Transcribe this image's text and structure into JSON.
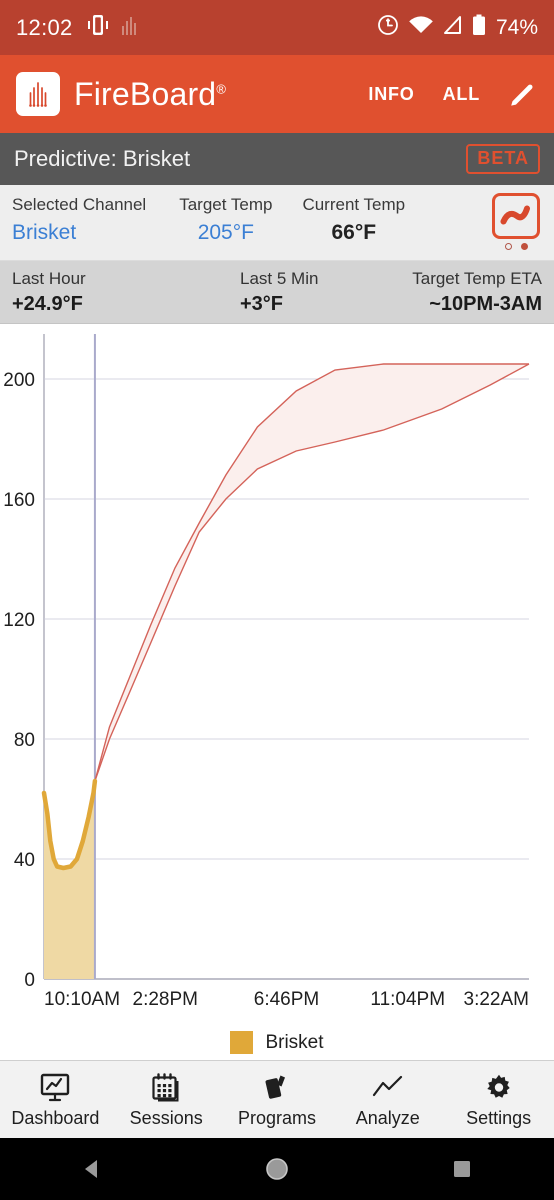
{
  "statusbar": {
    "time": "12:02",
    "battery_percent": "74%",
    "icons": [
      "vibrate-icon",
      "signal-bars-icon",
      "alarm-icon",
      "wifi-icon",
      "cell-signal-icon",
      "battery-icon"
    ]
  },
  "appbar": {
    "brand": "FireBoard",
    "registered_mark": "®",
    "info_label": "INFO",
    "all_label": "ALL",
    "edit_icon": "pencil-icon",
    "bg_color": "#e0502f"
  },
  "predictive": {
    "title": "Predictive: Brisket",
    "badge": "BETA",
    "badge_color": "#e0502f"
  },
  "info": {
    "selected_channel_label": "Selected Channel",
    "selected_channel_value": "Brisket",
    "target_temp_label": "Target Temp",
    "target_temp_value": "205°F",
    "current_temp_label": "Current Temp",
    "current_temp_value": "66°F",
    "link_color": "#3b7fd4",
    "mode_icon": "brisket-curve-icon",
    "page_dots": 2,
    "active_dot": 2
  },
  "stats": {
    "last_hour_label": "Last Hour",
    "last_hour_value": "+24.9°F",
    "last_5min_label": "Last 5 Min",
    "last_5min_value": "+3°F",
    "eta_label": "Target Temp ETA",
    "eta_value": "~10PM-3AM"
  },
  "chart_data": {
    "type": "line",
    "title": "Predictive: Brisket",
    "xlabel": "",
    "ylabel": "",
    "grid": true,
    "legend_position": "bottom",
    "ylim": [
      0,
      215
    ],
    "yticks": [
      0,
      40,
      80,
      120,
      160,
      200
    ],
    "ytick_labels": [
      "0",
      "40",
      "80",
      "120",
      "160",
      "200"
    ],
    "xtick_labels": [
      "10:10AM",
      "2:28PM",
      "6:46PM",
      "11:04PM",
      "3:22AM"
    ],
    "xtick_positions": [
      0,
      0.25,
      0.5,
      0.75,
      1.0
    ],
    "now_marker_x": 0.105,
    "colors": {
      "actual_line": "#e0a839",
      "actual_fill": "#efd9a4",
      "prediction_line": "#d4635a",
      "prediction_fill": "#fbefed",
      "grid": "#c9c9d9",
      "now_line": "#a9aacb"
    },
    "series": [
      {
        "name": "Brisket",
        "kind": "actual",
        "points": [
          [
            0.0,
            62
          ],
          [
            0.007,
            55
          ],
          [
            0.013,
            46
          ],
          [
            0.02,
            40
          ],
          [
            0.027,
            37.5
          ],
          [
            0.04,
            37
          ],
          [
            0.055,
            37.5
          ],
          [
            0.068,
            40
          ],
          [
            0.08,
            46
          ],
          [
            0.092,
            54
          ],
          [
            0.102,
            62
          ],
          [
            0.105,
            66
          ]
        ]
      },
      {
        "name": "Prediction Upper",
        "kind": "prediction-upper",
        "points": [
          [
            0.105,
            66
          ],
          [
            0.135,
            84
          ],
          [
            0.175,
            100
          ],
          [
            0.22,
            118
          ],
          [
            0.27,
            137
          ],
          [
            0.32,
            152
          ],
          [
            0.375,
            168
          ],
          [
            0.44,
            184
          ],
          [
            0.52,
            196
          ],
          [
            0.6,
            203
          ],
          [
            0.7,
            205
          ],
          [
            0.85,
            205
          ],
          [
            1.0,
            205
          ]
        ]
      },
      {
        "name": "Prediction Lower",
        "kind": "prediction-lower",
        "points": [
          [
            0.105,
            66
          ],
          [
            0.135,
            80
          ],
          [
            0.175,
            95
          ],
          [
            0.22,
            112
          ],
          [
            0.27,
            131
          ],
          [
            0.32,
            149
          ],
          [
            0.375,
            160
          ],
          [
            0.44,
            170
          ],
          [
            0.52,
            176
          ],
          [
            0.6,
            179
          ],
          [
            0.7,
            183
          ],
          [
            0.82,
            190
          ],
          [
            0.92,
            198
          ],
          [
            1.0,
            205
          ]
        ]
      }
    ],
    "legend": [
      {
        "label": "Brisket",
        "color": "#e0a839"
      }
    ]
  },
  "bottomnav": {
    "items": [
      {
        "label": "Dashboard",
        "icon": "dashboard-chart-icon"
      },
      {
        "label": "Sessions",
        "icon": "calendar-icon"
      },
      {
        "label": "Programs",
        "icon": "cards-icon"
      },
      {
        "label": "Analyze",
        "icon": "line-chart-icon"
      },
      {
        "label": "Settings",
        "icon": "gear-icon"
      }
    ]
  },
  "sysnav": {
    "back": "back-triangle-icon",
    "home": "home-circle-icon",
    "recents": "recents-square-icon"
  }
}
